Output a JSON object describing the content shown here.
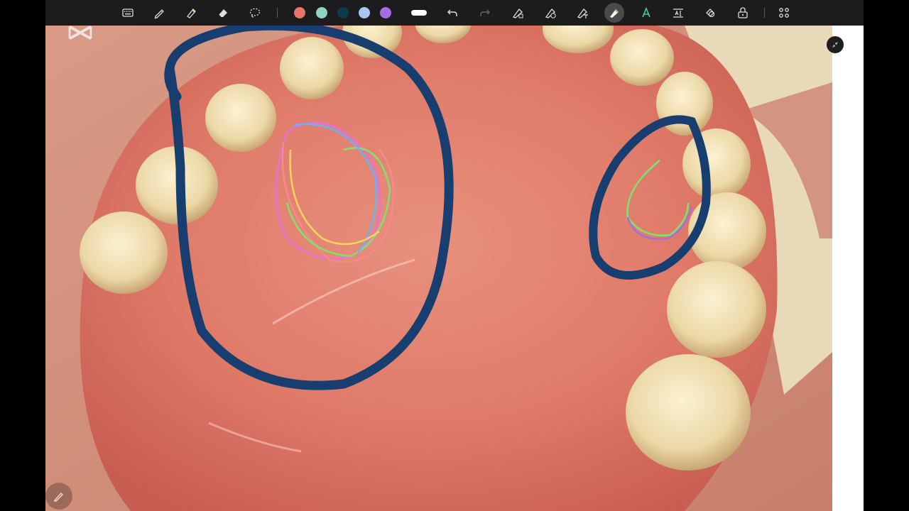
{
  "toolbar": {
    "tools": [
      {
        "name": "keyboard-icon"
      },
      {
        "name": "pen-icon"
      },
      {
        "name": "highlighter-icon"
      },
      {
        "name": "eraser-icon"
      },
      {
        "name": "lasso-icon"
      }
    ],
    "colors": [
      "#e8736b",
      "#8fd3c1",
      "#0e3b4a",
      "#a9c4f5",
      "#a46ee0"
    ],
    "accent": "#1f4e86",
    "actions": [
      {
        "name": "undo-icon"
      },
      {
        "name": "redo-icon"
      },
      {
        "name": "shape-pen-icon"
      },
      {
        "name": "timer-pen-icon"
      },
      {
        "name": "text-pen-icon"
      },
      {
        "name": "laser-pen-icon"
      },
      {
        "name": "text-tool-icon"
      },
      {
        "name": "text-box-icon"
      },
      {
        "name": "shapes-icon"
      },
      {
        "name": "lock-icon"
      },
      {
        "name": "grid-menu-icon"
      }
    ]
  },
  "annotations": {
    "large_circle_color": "#173e6e",
    "small_circle_color": "#173e6e",
    "rainbow_colors": [
      "#e86fd8",
      "#f7d45c",
      "#7fe36b",
      "#6fb0f0",
      "#f58a8a"
    ]
  },
  "watermark": {
    "icon": "capcut-logo-icon"
  }
}
